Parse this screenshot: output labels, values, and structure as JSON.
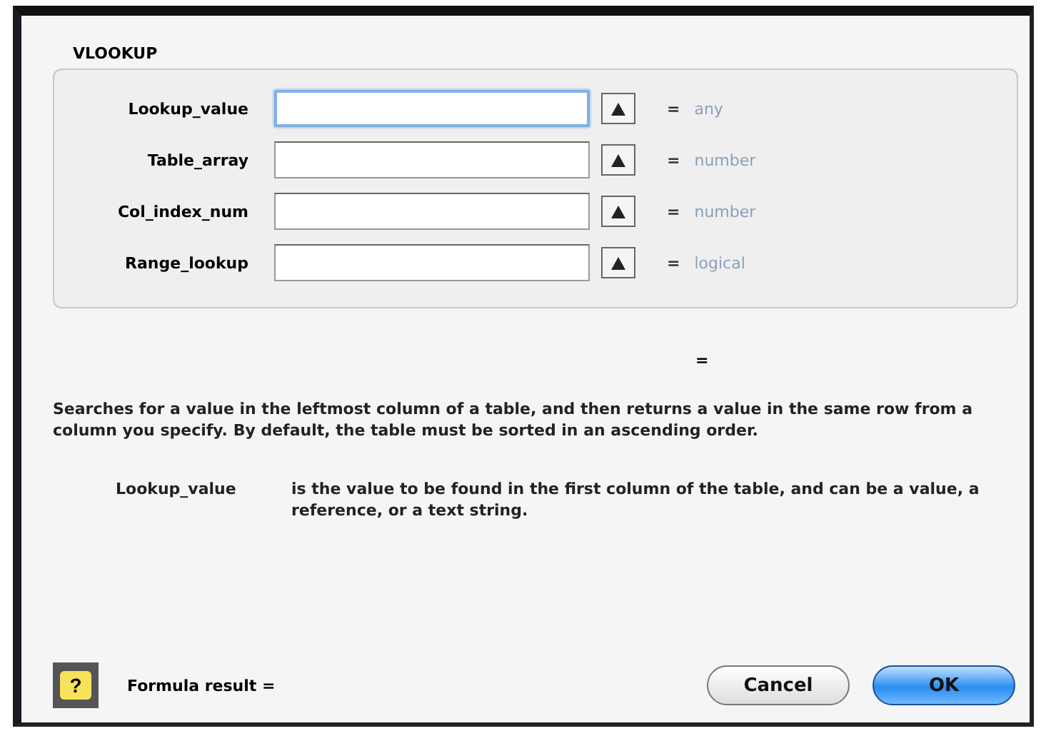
{
  "function_name": "VLOOKUP",
  "arguments": [
    {
      "label": "Lookup_value",
      "equals": "=",
      "type": "any",
      "focused": true
    },
    {
      "label": "Table_array",
      "equals": "=",
      "type": "number",
      "focused": false
    },
    {
      "label": "Col_index_num",
      "equals": "=",
      "type": "number",
      "focused": false
    },
    {
      "label": "Range_lookup",
      "equals": "=",
      "type": "logical",
      "focused": false
    }
  ],
  "result_equals": "=",
  "description": "Searches for a value in the leftmost column of a table, and then returns a value in the same row from a column you specify. By default, the table must be sorted in an ascending order.",
  "argument_help": {
    "name": "Lookup_value",
    "text": "is the value to be found in the first column of the table, and can be a value, a reference, or a text string."
  },
  "help_button": {
    "label": "?"
  },
  "formula_result": "Formula result =",
  "buttons": [
    {
      "label": "Cancel",
      "default": false
    },
    {
      "label": "OK",
      "default": true
    }
  ]
}
